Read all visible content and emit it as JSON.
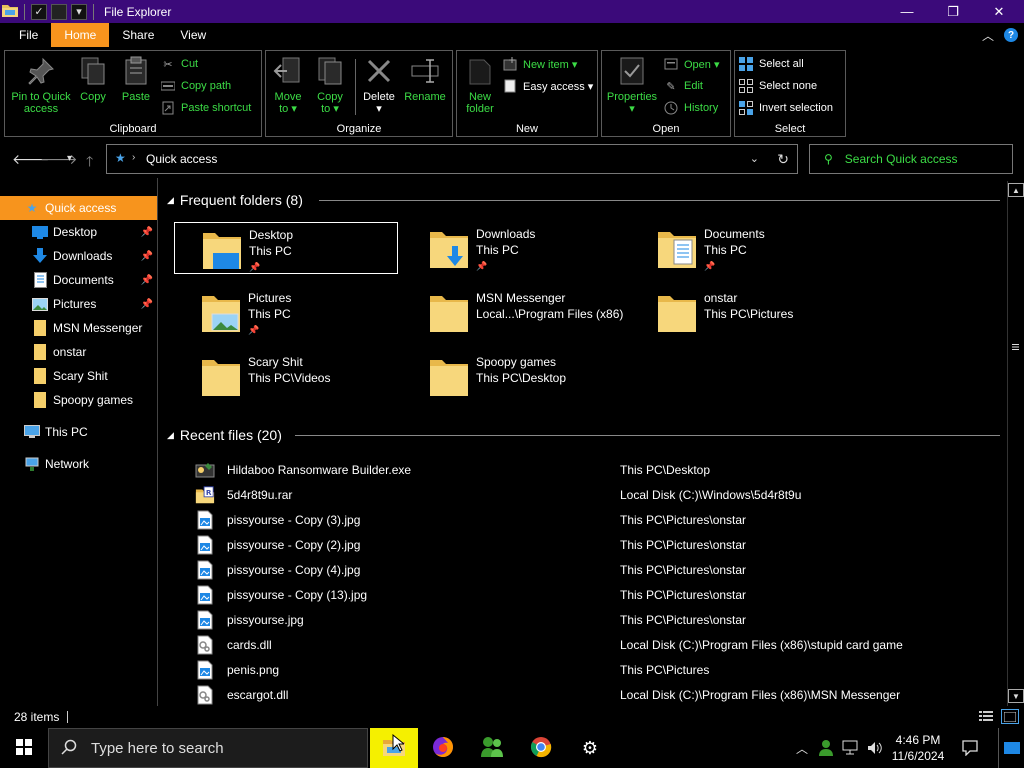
{
  "window": {
    "title": "File Explorer",
    "minimize": "—",
    "maximize": "❐",
    "close": "✕"
  },
  "ribbon_tabs": [
    "File",
    "Home",
    "Share",
    "View"
  ],
  "ribbon": {
    "clipboard": {
      "label": "Clipboard",
      "pin": "Pin to Quick\naccess",
      "pin_line1": "Pin to Quick",
      "pin_line2": "access",
      "copy": "Copy",
      "paste": "Paste",
      "cut": "Cut",
      "copy_path": "Copy path",
      "paste_shortcut": "Paste shortcut"
    },
    "organize": {
      "label": "Organize",
      "move_to_1": "Move",
      "move_to_2": "to ▾",
      "copy_to_1": "Copy",
      "copy_to_2": "to ▾",
      "delete": "Delete",
      "delete_arrow": "▾",
      "rename": "Rename"
    },
    "new": {
      "label": "New",
      "new_folder_1": "New",
      "new_folder_2": "folder",
      "new_item": "New item ▾",
      "easy_access": "Easy access ▾"
    },
    "open": {
      "label": "Open",
      "properties": "Properties",
      "properties_arrow": "▾",
      "open": "Open ▾",
      "edit": "Edit",
      "history": "History"
    },
    "select": {
      "label": "Select",
      "select_all": "Select all",
      "select_none": "Select none",
      "invert": "Invert selection"
    }
  },
  "address": {
    "location": "Quick access",
    "search_placeholder": "Search Quick access"
  },
  "nav": [
    {
      "label": "Quick access",
      "pinned": false
    },
    {
      "label": "Desktop",
      "pinned": true
    },
    {
      "label": "Downloads",
      "pinned": true
    },
    {
      "label": "Documents",
      "pinned": true
    },
    {
      "label": "Pictures",
      "pinned": true
    },
    {
      "label": "MSN Messenger",
      "pinned": false
    },
    {
      "label": "onstar",
      "pinned": false
    },
    {
      "label": "Scary Shit",
      "pinned": false
    },
    {
      "label": "Spoopy games",
      "pinned": false
    },
    {
      "label": "This PC",
      "pinned": false
    },
    {
      "label": "Network",
      "pinned": false
    }
  ],
  "pin_glyph": "📌",
  "frequent": {
    "title": "Frequent folders (8)",
    "items": [
      {
        "name": "Desktop",
        "location": "This PC",
        "pinned": "📌"
      },
      {
        "name": "Downloads",
        "location": "This PC",
        "pinned": "📌"
      },
      {
        "name": "Documents",
        "location": "This PC",
        "pinned": "📌"
      },
      {
        "name": "Pictures",
        "location": "This PC",
        "pinned": "📌"
      },
      {
        "name": "MSN Messenger",
        "location": "Local...\\Program Files (x86)",
        "pinned": ""
      },
      {
        "name": "onstar",
        "location": "This PC\\Pictures",
        "pinned": ""
      },
      {
        "name": "Scary Shit",
        "location": "This PC\\Videos",
        "pinned": ""
      },
      {
        "name": "Spoopy games",
        "location": "This PC\\Desktop",
        "pinned": ""
      }
    ]
  },
  "recent": {
    "title": "Recent files (20)",
    "items": [
      {
        "name": "Hildaboo Ransomware Builder.exe",
        "path": "This PC\\Desktop",
        "icon": "exe-icon"
      },
      {
        "name": "5d4r8t9u.rar",
        "path": "Local Disk (C:)\\Windows\\5d4r8t9u",
        "icon": "rar-icon"
      },
      {
        "name": "pissyourse - Copy (3).jpg",
        "path": "This PC\\Pictures\\onstar",
        "icon": "image-file-icon"
      },
      {
        "name": "pissyourse - Copy (2).jpg",
        "path": "This PC\\Pictures\\onstar",
        "icon": "image-file-icon"
      },
      {
        "name": "pissyourse - Copy (4).jpg",
        "path": "This PC\\Pictures\\onstar",
        "icon": "image-file-icon"
      },
      {
        "name": "pissyourse - Copy (13).jpg",
        "path": "This PC\\Pictures\\onstar",
        "icon": "image-file-icon"
      },
      {
        "name": "pissyourse.jpg",
        "path": "This PC\\Pictures\\onstar",
        "icon": "image-file-icon"
      },
      {
        "name": "cards.dll",
        "path": "Local Disk (C:)\\Program Files (x86)\\stupid card game",
        "icon": "dll-icon"
      },
      {
        "name": "penis.png",
        "path": "This PC\\Pictures",
        "icon": "image-file-icon"
      },
      {
        "name": "escargot.dll",
        "path": "Local Disk (C:)\\Program Files (x86)\\MSN Messenger",
        "icon": "dll-icon"
      }
    ]
  },
  "status": {
    "count": "28 items"
  },
  "taskbar": {
    "search_placeholder": "Type here to search",
    "time": "4:46 PM",
    "date": "11/6/2024"
  },
  "colors": {
    "accent": "#f7941d",
    "title_bar": "#3b0a7a",
    "ribbon_text": "#3cdc46",
    "taskbar_active": "#f5f000"
  }
}
